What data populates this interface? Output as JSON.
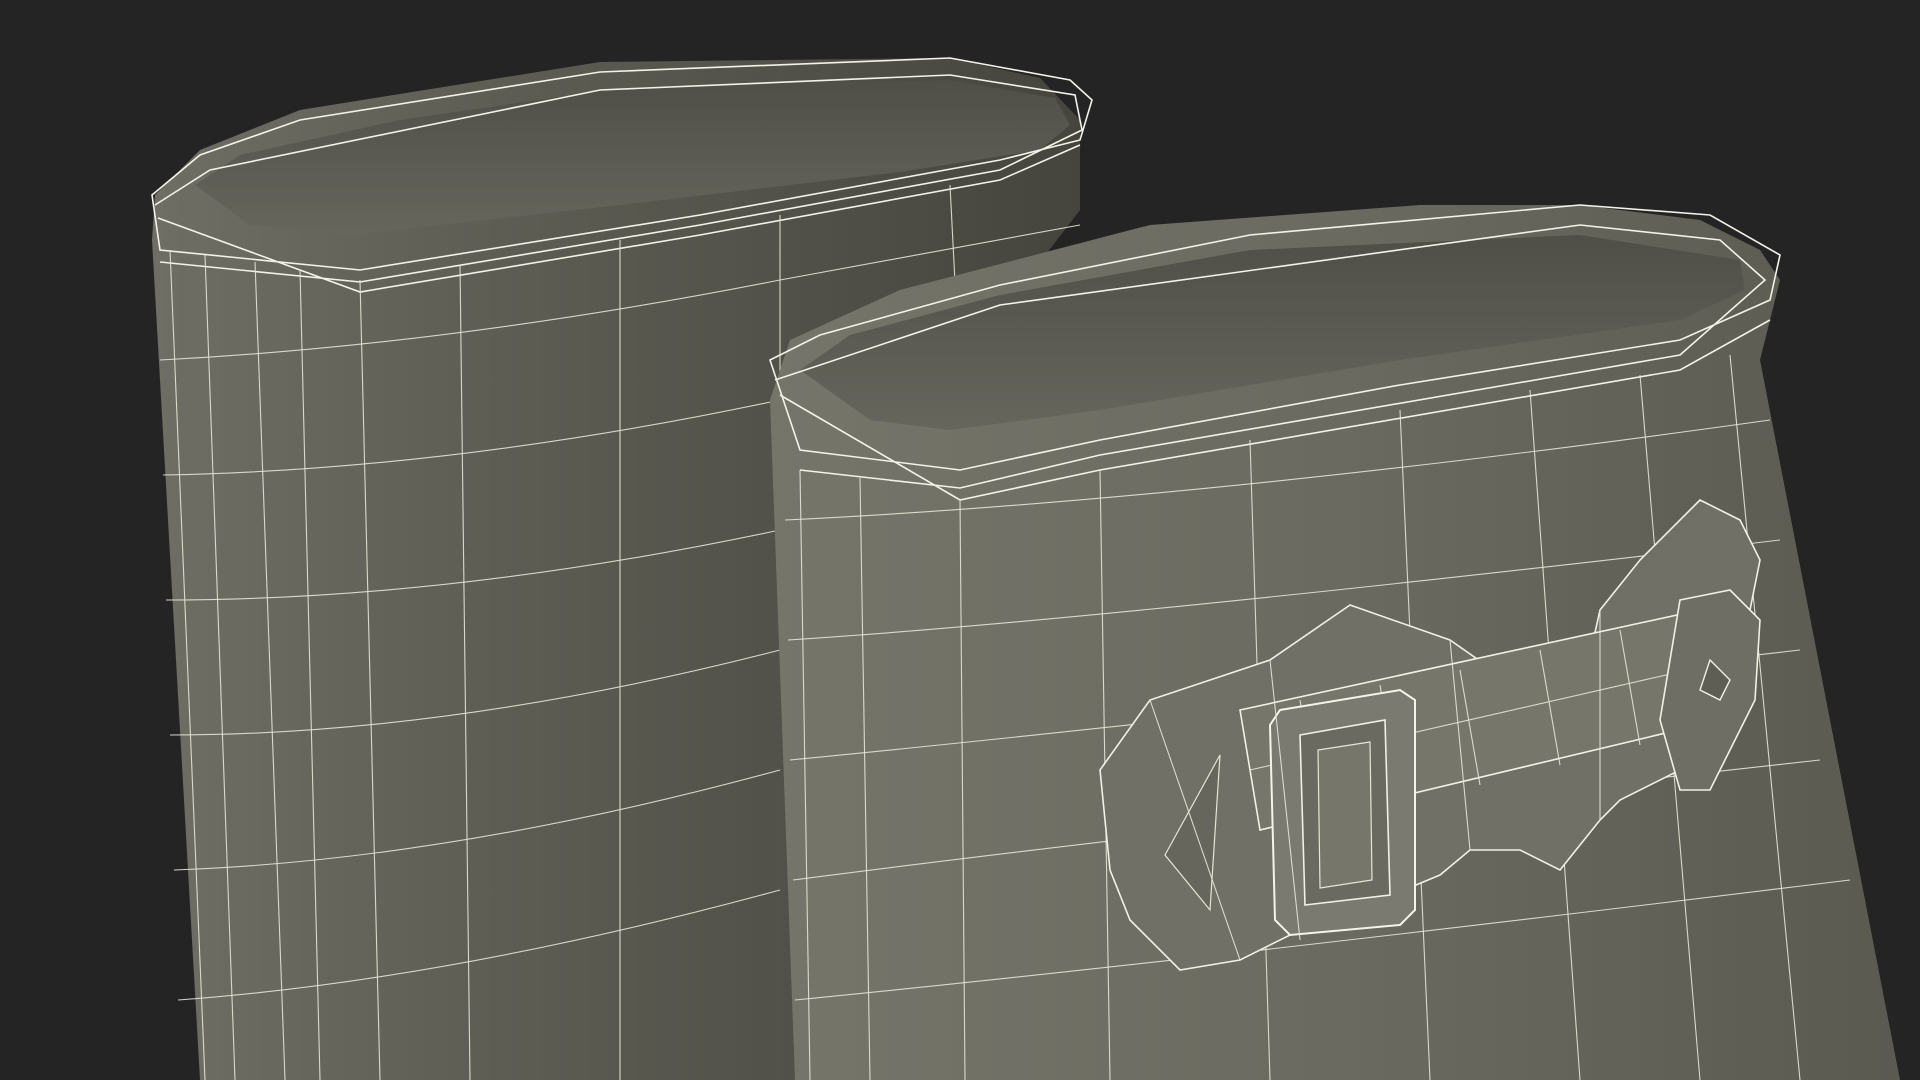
{
  "scene": {
    "subject": "wireframe-rain-boots",
    "colors": {
      "background": "#242424",
      "shaft": "#6c6c62",
      "shaft_dark": "#4e4e46",
      "interior": "#5a5a52",
      "wire": "#e6e6d6"
    }
  }
}
